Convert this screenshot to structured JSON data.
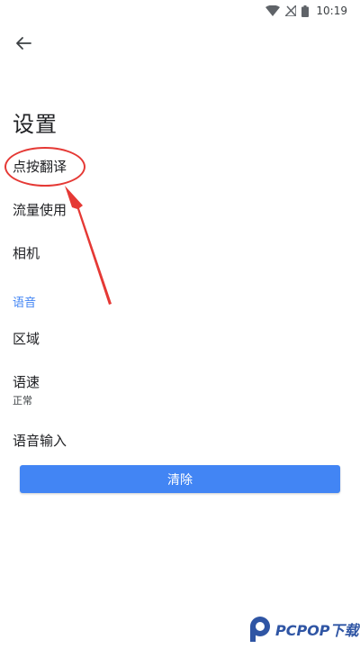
{
  "status_bar": {
    "time": "10:19",
    "icons": [
      "wifi-icon",
      "no-signal-icon",
      "battery-icon"
    ]
  },
  "header": {
    "back_icon": "arrow-left-icon"
  },
  "page": {
    "title": "设置"
  },
  "settings": {
    "items": [
      {
        "label": "点按翻译"
      },
      {
        "label": "流量使用"
      },
      {
        "label": "相机"
      }
    ],
    "voice_section": {
      "header": "语音",
      "items": [
        {
          "label": "区域"
        },
        {
          "label": "语速",
          "value": "正常"
        },
        {
          "label": "语音输入"
        }
      ]
    }
  },
  "actions": {
    "clear_label": "清除"
  },
  "annotation": {
    "color": "#e53935"
  },
  "watermark": {
    "text": "PCPOP下载",
    "color": "#2f55a4"
  },
  "colors": {
    "accent": "#4285f4"
  }
}
